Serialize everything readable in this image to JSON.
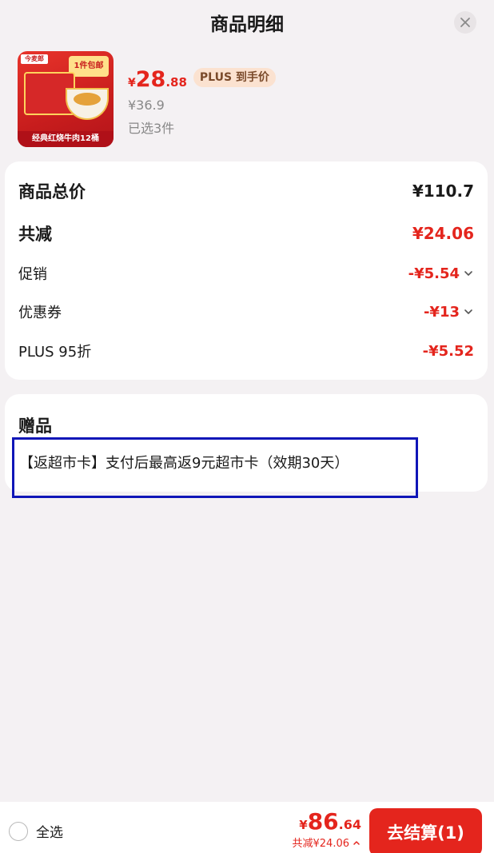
{
  "header": {
    "title": "商品明细"
  },
  "product": {
    "thumbnail": {
      "brand": "今麦郎",
      "promo": "1件包邮",
      "caption": "经典红烧牛肉12桶"
    },
    "price": {
      "currency": "¥",
      "integer": "28",
      "decimal": ".88"
    },
    "plus_badge": "PLUS 到手价",
    "original_price": "¥36.9",
    "selected": "已选3件"
  },
  "summary": {
    "total_label": "商品总价",
    "total_value": "¥110.7",
    "reduce_label": "共减",
    "reduce_value": "¥24.06",
    "promo_label": "促销",
    "promo_value": "-¥5.54",
    "coupon_label": "优惠券",
    "coupon_value": "-¥13",
    "plus_label": "PLUS 95折",
    "plus_value": "-¥5.52"
  },
  "gift": {
    "title": "赠品",
    "text": "【返超市卡】支付后最高返9元超市卡（效期30天）"
  },
  "footer": {
    "select_all": "全选",
    "total": {
      "currency": "¥",
      "integer": "86",
      "decimal": ".64"
    },
    "reduce": "共减¥24.06",
    "checkout": "去结算(1)"
  },
  "colors": {
    "accent": "#e4251d",
    "background": "#f4f1f3",
    "highlight": "#1016b8"
  },
  "icons": [
    "close-icon",
    "chevron-down-icon",
    "chevron-up-icon",
    "radio-icon"
  ]
}
